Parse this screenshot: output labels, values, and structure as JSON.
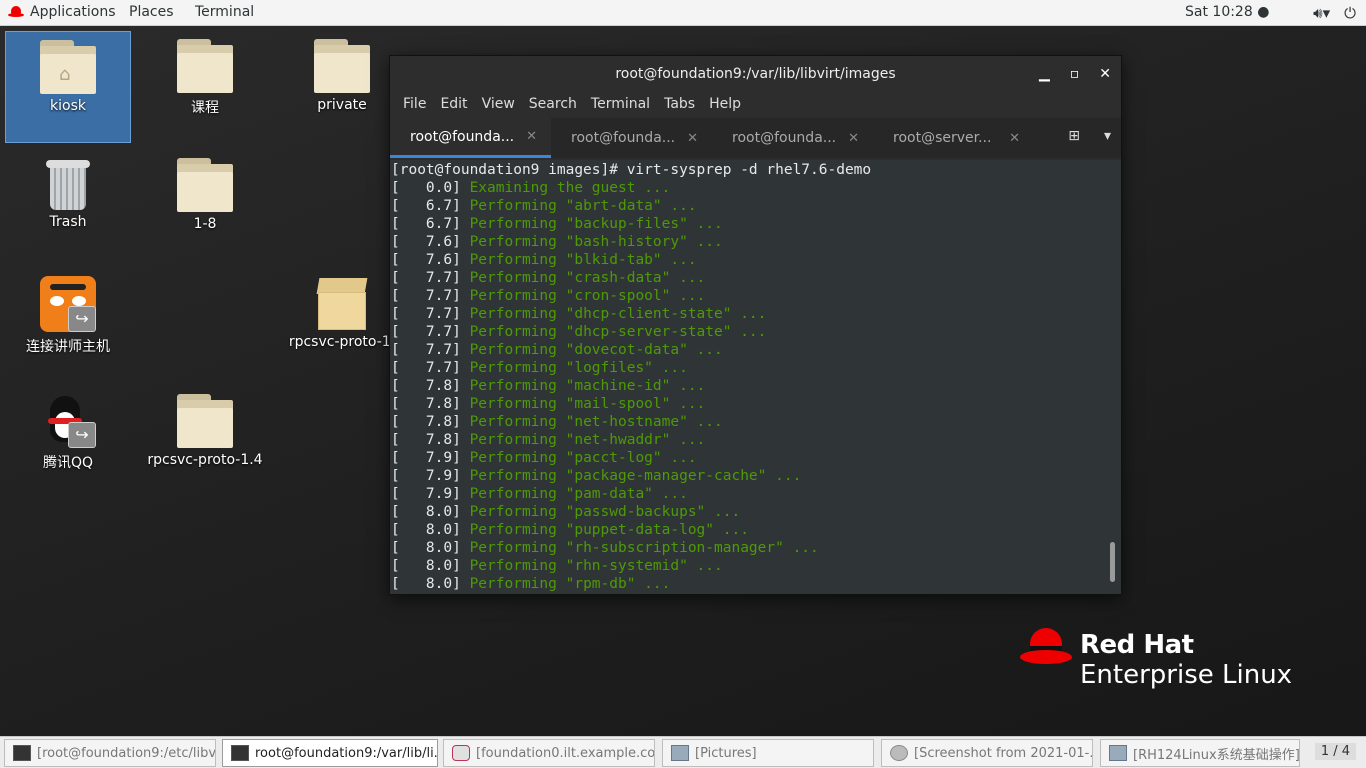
{
  "topbar": {
    "applications": "Applications",
    "places": "Places",
    "terminal": "Terminal",
    "clock": "Sat 10:28 ●",
    "volume_icon": "🔊︎▾",
    "power_icon": "⏻"
  },
  "desktop": {
    "icons": [
      {
        "label": "kiosk"
      },
      {
        "label": "课程"
      },
      {
        "label": "private"
      },
      {
        "label": "Trash"
      },
      {
        "label": "1-8"
      },
      {
        "label": "连接讲师主机"
      },
      {
        "label": "rpcsvc-proto-1."
      },
      {
        "label": "腾讯QQ"
      },
      {
        "label": "rpcsvc-proto-1.4"
      }
    ]
  },
  "terminal": {
    "title": "root@foundation9:/var/lib/libvirt/images",
    "menu": [
      "File",
      "Edit",
      "View",
      "Search",
      "Terminal",
      "Tabs",
      "Help"
    ],
    "tabs": [
      {
        "label": "root@founda..."
      },
      {
        "label": "root@founda..."
      },
      {
        "label": "root@founda..."
      },
      {
        "label": "root@server..."
      }
    ],
    "prompt_line": "[root@foundation9 images]# virt-sysprep -d rhel7.6-demo",
    "output": [
      {
        "time": "[   0.0]",
        "msg": "Examining the guest ..."
      },
      {
        "time": "[   6.7]",
        "msg": "Performing \"abrt-data\" ..."
      },
      {
        "time": "[   6.7]",
        "msg": "Performing \"backup-files\" ..."
      },
      {
        "time": "[   7.6]",
        "msg": "Performing \"bash-history\" ..."
      },
      {
        "time": "[   7.6]",
        "msg": "Performing \"blkid-tab\" ..."
      },
      {
        "time": "[   7.7]",
        "msg": "Performing \"crash-data\" ..."
      },
      {
        "time": "[   7.7]",
        "msg": "Performing \"cron-spool\" ..."
      },
      {
        "time": "[   7.7]",
        "msg": "Performing \"dhcp-client-state\" ..."
      },
      {
        "time": "[   7.7]",
        "msg": "Performing \"dhcp-server-state\" ..."
      },
      {
        "time": "[   7.7]",
        "msg": "Performing \"dovecot-data\" ..."
      },
      {
        "time": "[   7.7]",
        "msg": "Performing \"logfiles\" ..."
      },
      {
        "time": "[   7.8]",
        "msg": "Performing \"machine-id\" ..."
      },
      {
        "time": "[   7.8]",
        "msg": "Performing \"mail-spool\" ..."
      },
      {
        "time": "[   7.8]",
        "msg": "Performing \"net-hostname\" ..."
      },
      {
        "time": "[   7.8]",
        "msg": "Performing \"net-hwaddr\" ..."
      },
      {
        "time": "[   7.9]",
        "msg": "Performing \"pacct-log\" ..."
      },
      {
        "time": "[   7.9]",
        "msg": "Performing \"package-manager-cache\" ..."
      },
      {
        "time": "[   7.9]",
        "msg": "Performing \"pam-data\" ..."
      },
      {
        "time": "[   8.0]",
        "msg": "Performing \"passwd-backups\" ..."
      },
      {
        "time": "[   8.0]",
        "msg": "Performing \"puppet-data-log\" ..."
      },
      {
        "time": "[   8.0]",
        "msg": "Performing \"rh-subscription-manager\" ..."
      },
      {
        "time": "[   8.0]",
        "msg": "Performing \"rhn-systemid\" ..."
      },
      {
        "time": "[   8.0]",
        "msg": "Performing \"rpm-db\" ..."
      }
    ]
  },
  "brand": {
    "line1": "Red Hat",
    "line2": "Enterprise Linux"
  },
  "taskbar": {
    "tasks": [
      {
        "label": "[root@foundation9:/etc/libv..."
      },
      {
        "label": "root@foundation9:/var/lib/li..."
      },
      {
        "label": "[foundation0.ilt.example.co..."
      },
      {
        "label": "[Pictures]"
      },
      {
        "label": "[Screenshot from 2021-01-..."
      },
      {
        "label": "[RH124Linux系统基础操作]"
      }
    ],
    "pager": "1 / 4"
  },
  "colors": {
    "terminal_green": "#4e9a06",
    "active_tab": "#3b86d8",
    "redhat_red": "#ee0000"
  }
}
